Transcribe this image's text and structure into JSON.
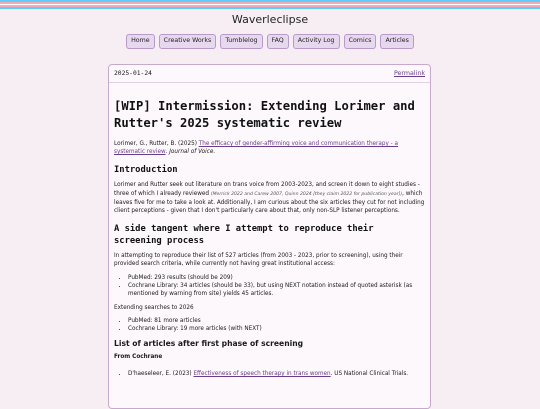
{
  "colors": {
    "stripes": [
      "#5bcefa",
      "#f5a9b8",
      "#ffffff",
      "#f5a9b8",
      "#5bcefa"
    ],
    "accent": "#6a3d8a"
  },
  "site": {
    "title": "Waverleclipse"
  },
  "nav": [
    "Home",
    "Creative Works",
    "Tumblelog",
    "FAQ",
    "Activity Log",
    "Comics",
    "Articles"
  ],
  "post": {
    "date": "2025-01-24",
    "permalink": "Permalink",
    "title": "[WIP] Intermission: Extending Lorimer and Rutter's 2025 systematic review",
    "citation": {
      "authors": "Lorimer, G., Rutter, B. (2025) ",
      "title_link": "The efficacy of gender-affirming voice and communication therapy - a systematic review",
      "journal": ". Journal of Voice."
    },
    "intro_heading": "Introduction",
    "intro_p1": "Lorimer and Rutter seek out literature on trans voice from 2003-2023, and screen it down to eight studies - three of which I already reviewed ",
    "intro_small": "(Merrick 2022 and Carew 2007, Quinn 2024 [they claim 2022 for publication year])",
    "intro_p2": ", which leaves five for me to take a look at. Additionally, I am curious about the six articles they cut for not including client perceptions - given that I don't particularly care about that, only non-SLP listener perceptions.",
    "side_heading": "A side tangent where I attempt to reproduce their screening process",
    "side_p": "In attempting to reproduce their list of 527 articles (from 2003 - 2023, prior to screening), using their provided search criteria, while currently not having great institutional access:",
    "side_list": [
      "PubMed: 293 results (should be 209)",
      "Cochrane Library: 34 articles (should be 33), but using NEXT notation instead of quoted asterisk (as mentioned by warning from site) yields 45 articles."
    ],
    "extend_p": "Extending searches to 2026",
    "extend_list": [
      "PubMed: 81 more articles",
      "Cochrane Library: 19 more articles (with NEXT)"
    ],
    "list_heading": "List of articles after first phase of screening",
    "from_heading": "From Cochrane",
    "cochrane_item": {
      "prefix": "D'haeseleer, E. (2023) ",
      "link": "Effectiveness of speech therapy in trans women",
      "suffix": ". US National Clinical Trials."
    }
  }
}
